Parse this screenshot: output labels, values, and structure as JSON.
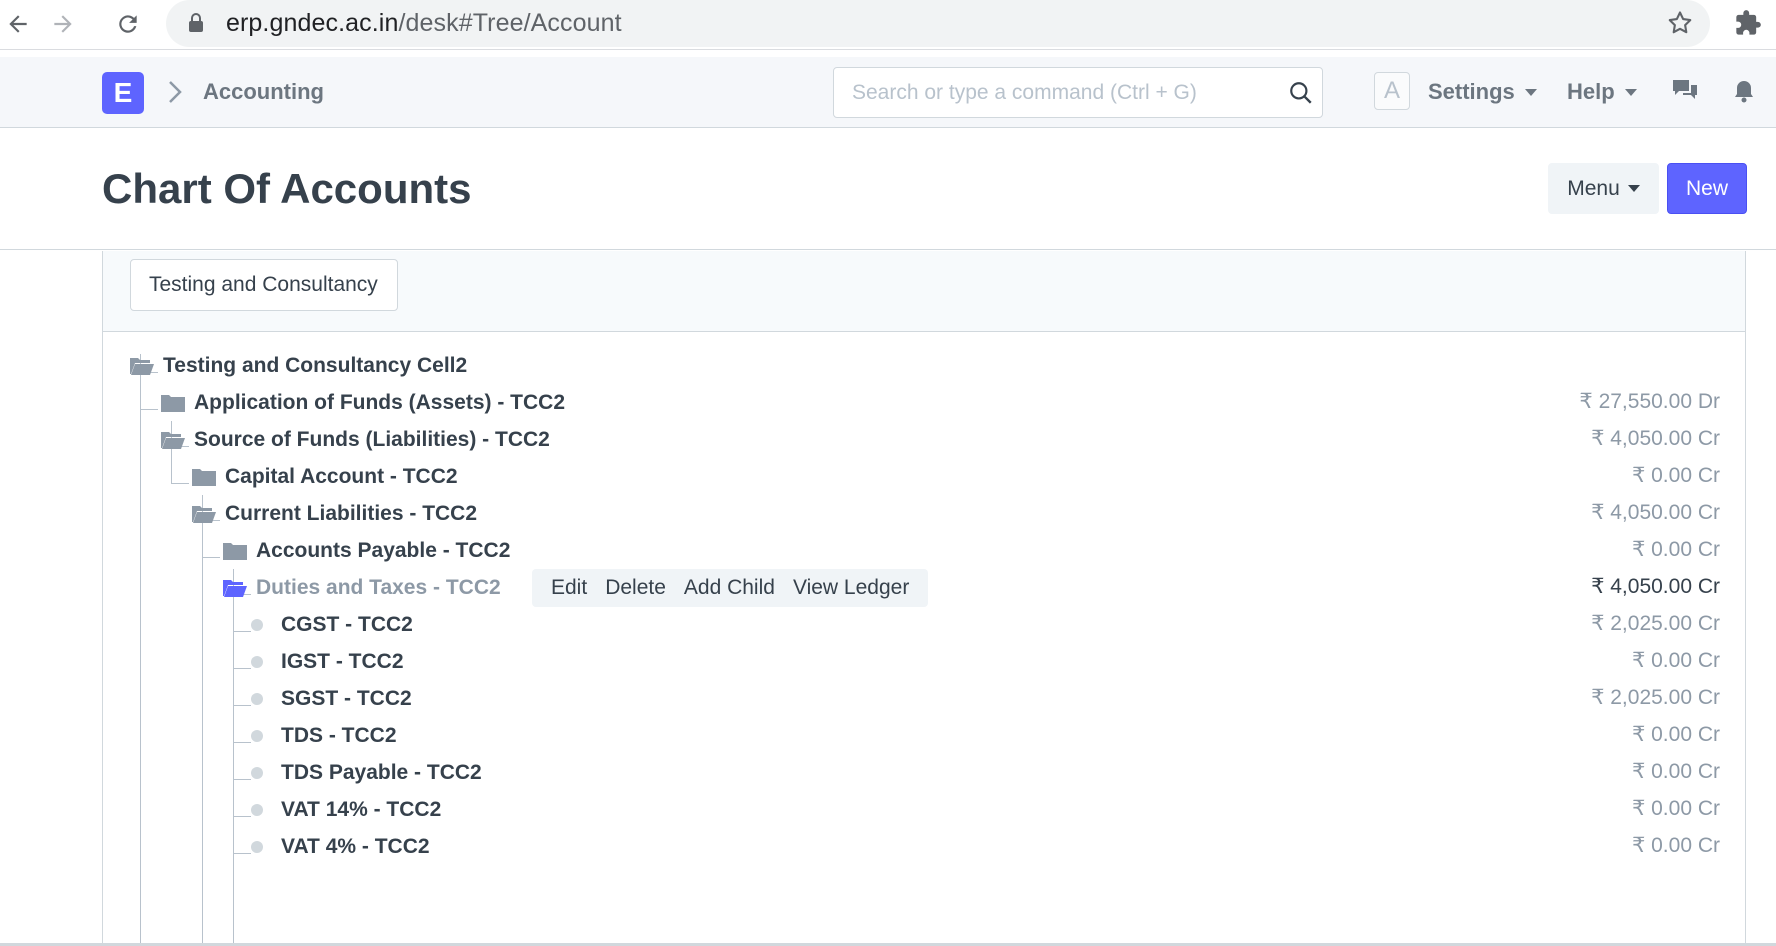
{
  "browser": {
    "url_host": "erp.gndec.ac.in",
    "url_path": "/desk#Tree/Account"
  },
  "navbar": {
    "logo_letter": "E",
    "breadcrumb": "Accounting",
    "search_placeholder": "Search or type a command (Ctrl + G)",
    "avatar_letter": "A",
    "settings_label": "Settings",
    "help_label": "Help"
  },
  "page": {
    "title": "Chart Of Accounts",
    "menu_label": "Menu",
    "new_label": "New"
  },
  "filter": {
    "company": "Testing and Consultancy"
  },
  "tree": {
    "root": "Testing and Consultancy Cell2",
    "nodes": [
      {
        "label": "Application of Funds (Assets) - TCC2",
        "balance": "₹ 27,550.00 Dr"
      },
      {
        "label": "Source of Funds (Liabilities) - TCC2",
        "balance": "₹ 4,050.00 Cr"
      },
      {
        "label": "Capital Account - TCC2",
        "balance": "₹ 0.00 Cr"
      },
      {
        "label": "Current Liabilities - TCC2",
        "balance": "₹ 4,050.00 Cr"
      },
      {
        "label": "Accounts Payable - TCC2",
        "balance": "₹ 0.00 Cr"
      },
      {
        "label": "Duties and Taxes - TCC2",
        "balance": "₹ 4,050.00 Cr"
      },
      {
        "label": "CGST - TCC2",
        "balance": "₹ 2,025.00 Cr"
      },
      {
        "label": "IGST - TCC2",
        "balance": "₹ 0.00 Cr"
      },
      {
        "label": "SGST - TCC2",
        "balance": "₹ 2,025.00 Cr"
      },
      {
        "label": "TDS - TCC2",
        "balance": "₹ 0.00 Cr"
      },
      {
        "label": "TDS Payable - TCC2",
        "balance": "₹ 0.00 Cr"
      },
      {
        "label": "VAT 14% - TCC2",
        "balance": "₹ 0.00 Cr"
      },
      {
        "label": "VAT 4% - TCC2",
        "balance": "₹ 0.00 Cr"
      }
    ],
    "toolbar": {
      "edit": "Edit",
      "delete": "Delete",
      "add_child": "Add Child",
      "view_ledger": "View Ledger"
    }
  },
  "colors": {
    "primary": "#5e64ff",
    "text": "#36414c",
    "muted": "#8d99a6",
    "folder": "#8d99a6"
  }
}
